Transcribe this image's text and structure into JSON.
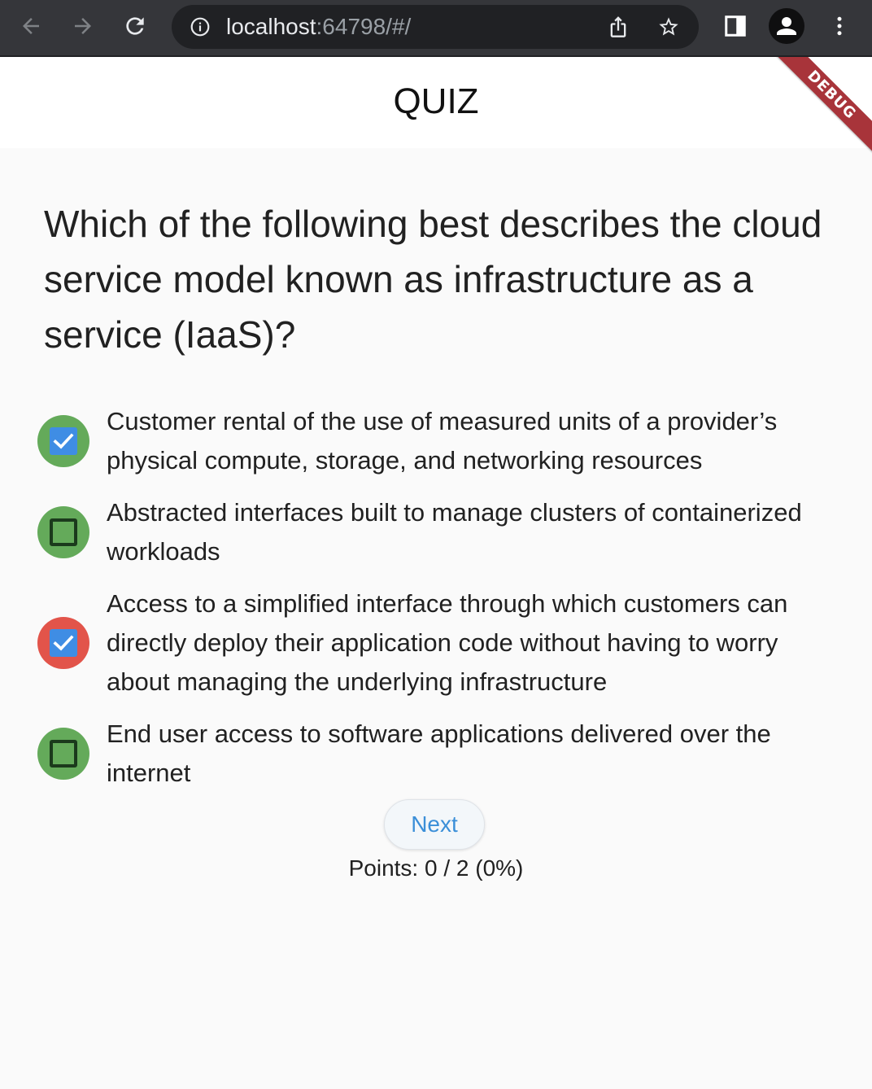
{
  "browser": {
    "url_host": "localhost",
    "url_rest": ":64798/#/",
    "icons": [
      "back-arrow-icon",
      "forward-arrow-icon",
      "reload-icon",
      "info-icon",
      "share-icon",
      "star-icon",
      "side-panel-icon",
      "profile-icon",
      "more-vert-icon"
    ]
  },
  "appbar": {
    "title": "QUIZ",
    "debug_label": "DEBUG"
  },
  "quiz": {
    "question": "Which of the following best describes the cloud service model known as infrastructure as a service (IaaS)?",
    "options": [
      {
        "text": "Customer rental of the use of measured units of a provider’s physical compute, storage, and networking resources",
        "checked": true,
        "status": "correct",
        "status_color": "#64aa5a"
      },
      {
        "text": "Abstracted interfaces built to manage clusters of containerized workloads",
        "checked": false,
        "status": "correct",
        "status_color": "#64aa5a"
      },
      {
        "text": "Access to a simplified interface through which customers can directly deploy their application code without having to worry about managing the underlying infrastructure",
        "checked": true,
        "status": "wrong",
        "status_color": "#e2544a"
      },
      {
        "text": "End user access to software applications delivered over the internet",
        "checked": false,
        "status": "correct",
        "status_color": "#64aa5a"
      }
    ],
    "next_label": "Next",
    "points_text": "Points: 0 / 2 (0%)"
  },
  "colors": {
    "accent": "#3b8fd8",
    "checkbox_checked": "#3f8de4",
    "correct": "#64aa5a",
    "wrong": "#e2544a",
    "debug_banner": "#a8343a"
  }
}
